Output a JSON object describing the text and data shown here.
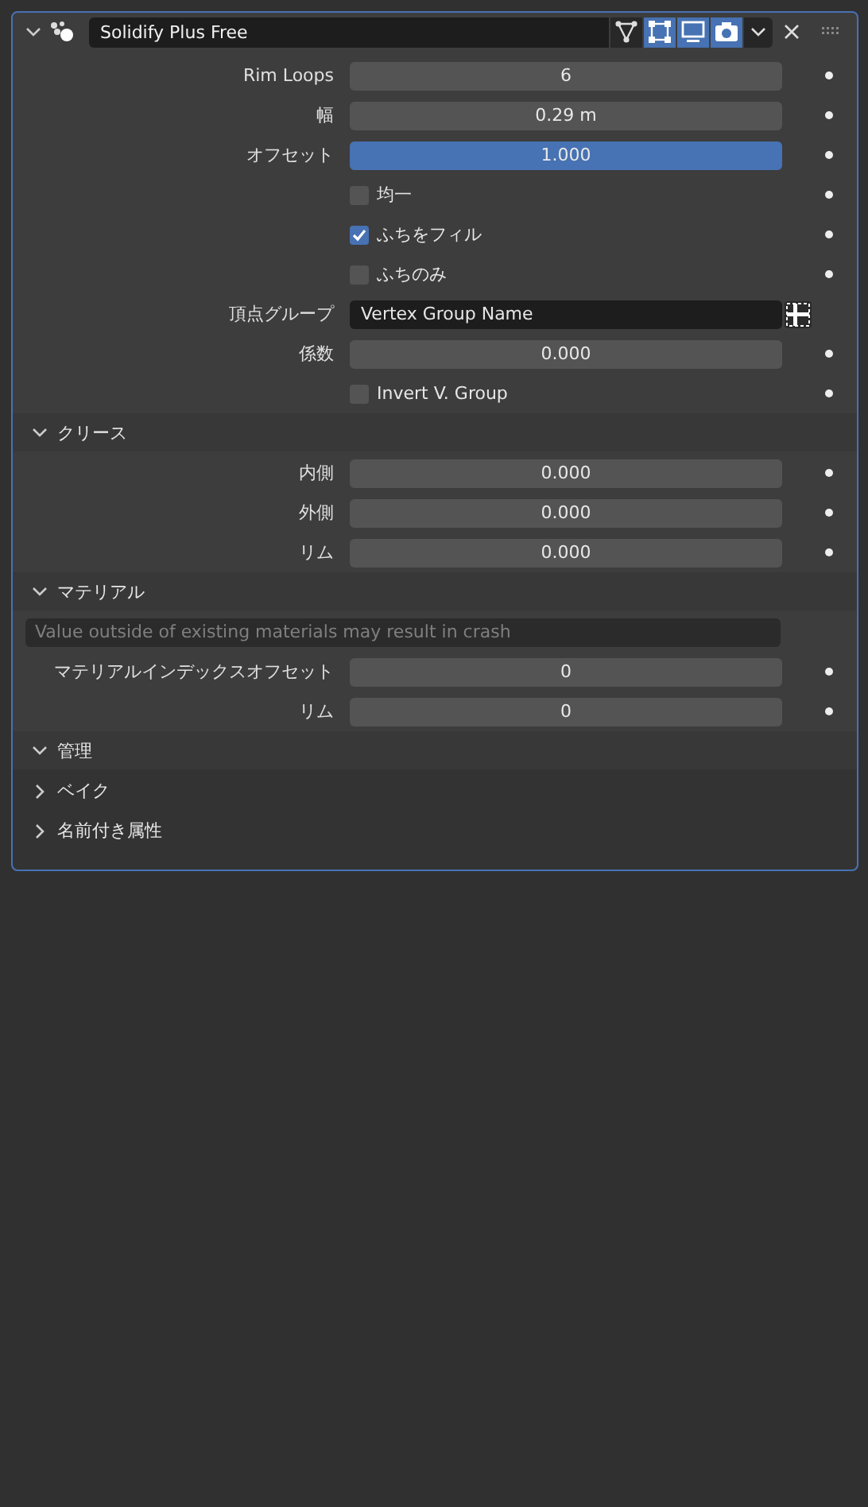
{
  "panel": {
    "title": "Solidify Plus Free",
    "expanded": true,
    "toggles": [
      {
        "kind": "cage",
        "on": false
      },
      {
        "kind": "editmode",
        "on": true
      },
      {
        "kind": "viewport",
        "on": true
      },
      {
        "kind": "render",
        "on": true
      }
    ],
    "rows": [
      {
        "kind": "number",
        "label": "Rim Loops",
        "value": "6"
      },
      {
        "kind": "number",
        "label": "幅",
        "value": "0.29 m"
      },
      {
        "kind": "slider",
        "label": "オフセット",
        "value": "1.000",
        "level": 1
      },
      {
        "kind": "checkbox",
        "label": "均一",
        "checked": false
      },
      {
        "kind": "checkbox",
        "label": "ふちをフィル",
        "checked": true
      },
      {
        "kind": "checkbox",
        "label": "ふちのみ",
        "checked": false
      },
      {
        "kind": "vgroup",
        "label": "頂点グループ",
        "value": "Vertex Group Name"
      },
      {
        "kind": "number",
        "label": "係数",
        "value": "0.000"
      },
      {
        "kind": "checkbox",
        "label": "Invert V. Group",
        "checked": false
      }
    ],
    "subpanels": [
      {
        "title": "クリース",
        "expanded": true,
        "rows": [
          {
            "kind": "number",
            "label": "内側",
            "value": "0.000"
          },
          {
            "kind": "number",
            "label": "外側",
            "value": "0.000"
          },
          {
            "kind": "number",
            "label": "リム",
            "value": "0.000"
          }
        ]
      },
      {
        "title": "マテリアル",
        "expanded": true,
        "rows": [
          {
            "kind": "info",
            "value": "Value outside of existing materials may result in crash"
          },
          {
            "kind": "number",
            "label": "マテリアルインデックスオフセット",
            "value": "0"
          },
          {
            "kind": "number",
            "label": "リム",
            "value": "0"
          }
        ]
      },
      {
        "title": "管理",
        "expanded": true,
        "children": [
          {
            "title": "ベイク",
            "expanded": false
          },
          {
            "title": "名前付き属性",
            "expanded": false
          }
        ]
      }
    ]
  }
}
